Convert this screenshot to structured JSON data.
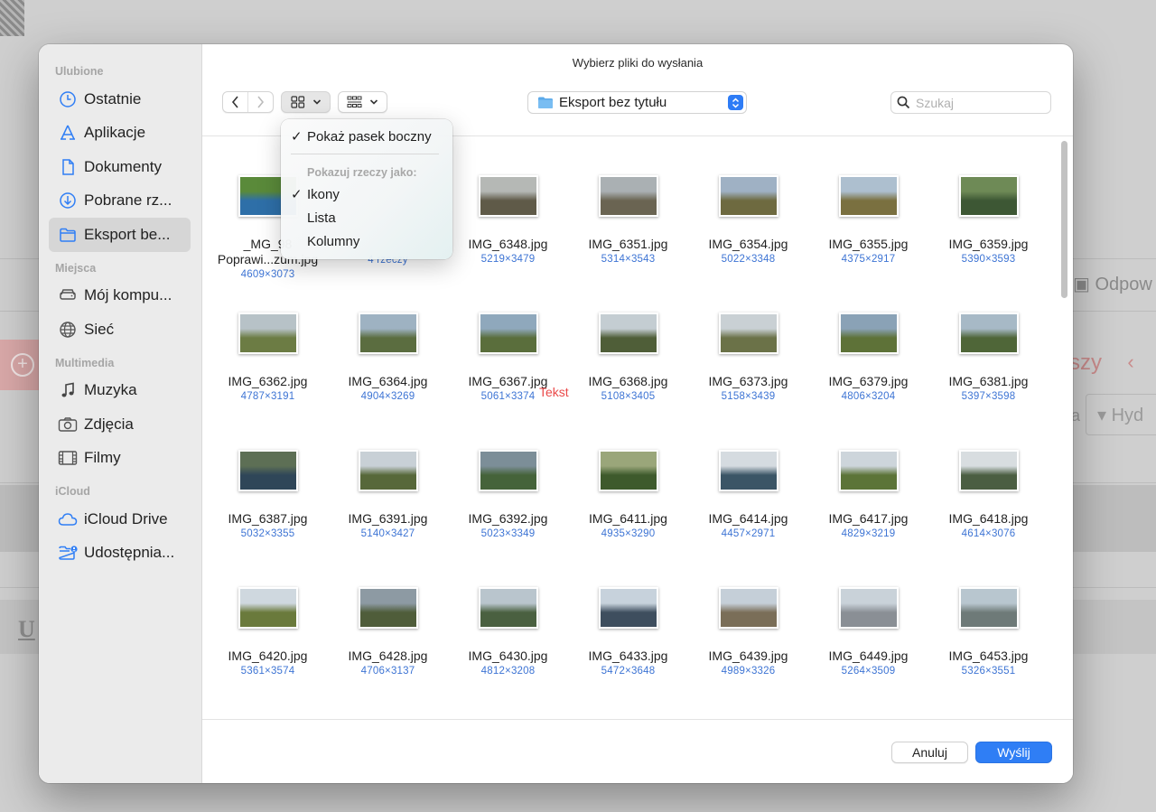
{
  "dialog_title": "Wybierz pliki do wysłania",
  "sidebar": {
    "sections": [
      {
        "title": "Ulubione",
        "items": [
          {
            "label": "Ostatnie",
            "icon": "clock-icon"
          },
          {
            "label": "Aplikacje",
            "icon": "apps-icon"
          },
          {
            "label": "Dokumenty",
            "icon": "document-icon"
          },
          {
            "label": "Pobrane rz...",
            "icon": "download-icon"
          },
          {
            "label": "Eksport be...",
            "icon": "folder-icon",
            "active": true
          }
        ]
      },
      {
        "title": "Miejsca",
        "items": [
          {
            "label": "Mój kompu...",
            "icon": "disk-icon"
          },
          {
            "label": "Sieć",
            "icon": "globe-icon"
          }
        ]
      },
      {
        "title": "Multimedia",
        "items": [
          {
            "label": "Muzyka",
            "icon": "music-icon"
          },
          {
            "label": "Zdjęcia",
            "icon": "camera-icon"
          },
          {
            "label": "Filmy",
            "icon": "film-icon"
          }
        ]
      },
      {
        "title": "iCloud",
        "items": [
          {
            "label": "iCloud Drive",
            "icon": "cloud-icon"
          },
          {
            "label": "Udostępnia...",
            "icon": "shared-folder-icon"
          }
        ]
      }
    ]
  },
  "path_popup": {
    "label": "Eksport bez tytułu"
  },
  "search": {
    "placeholder": "Szukaj"
  },
  "view_menu": {
    "show_sidebar": "Pokaż pasek boczny",
    "section_title": "Pokazuj rzeczy jako:",
    "options": [
      "Ikony",
      "Lista",
      "Kolumny"
    ],
    "selected": "Ikony"
  },
  "files": [
    {
      "name": "_MG_98",
      "name2": "Poprawi...zum.jpg",
      "dims": "4609×3073",
      "colors": [
        "#5a8a3a",
        "#2e6fa8"
      ]
    },
    {
      "name": "",
      "name2": "",
      "dims": "4 rzeczy",
      "colors": [
        "#e8e8e8",
        "#e8e8e8"
      ]
    },
    {
      "name": "IMG_6348.jpg",
      "dims": "5219×3479",
      "colors": [
        "#b5b8b5",
        "#5f5a48"
      ]
    },
    {
      "name": "IMG_6351.jpg",
      "dims": "5314×3543",
      "colors": [
        "#aab0b3",
        "#6a6452"
      ]
    },
    {
      "name": "IMG_6354.jpg",
      "dims": "5022×3348",
      "colors": [
        "#9fb1c4",
        "#6e6a40"
      ]
    },
    {
      "name": "IMG_6355.jpg",
      "dims": "4375×2917",
      "colors": [
        "#adbfcf",
        "#7a7040"
      ]
    },
    {
      "name": "IMG_6359.jpg",
      "dims": "5390×3593",
      "colors": [
        "#6e8a56",
        "#3d5734"
      ]
    },
    {
      "name": "IMG_6362.jpg",
      "dims": "4787×3191",
      "colors": [
        "#b7c2c7",
        "#6c7c44"
      ]
    },
    {
      "name": "IMG_6364.jpg",
      "dims": "4904×3269",
      "colors": [
        "#9eb2c2",
        "#5b6d40"
      ]
    },
    {
      "name": "IMG_6367.jpg",
      "dims": "5061×3374",
      "colors": [
        "#8fa8bc",
        "#5a6e3c"
      ]
    },
    {
      "name": "IMG_6368.jpg",
      "dims": "5108×3405",
      "colors": [
        "#c4cdd2",
        "#4f5e38"
      ]
    },
    {
      "name": "IMG_6373.jpg",
      "dims": "5158×3439",
      "colors": [
        "#c9d0d4",
        "#6b7248"
      ]
    },
    {
      "name": "IMG_6379.jpg",
      "dims": "4806×3204",
      "colors": [
        "#8aa2b6",
        "#5e7238"
      ]
    },
    {
      "name": "IMG_6381.jpg",
      "dims": "5397×3598",
      "colors": [
        "#a7b9c6",
        "#4f6638"
      ]
    },
    {
      "name": "IMG_6387.jpg",
      "dims": "5032×3355",
      "colors": [
        "#5d6f55",
        "#2f4658"
      ]
    },
    {
      "name": "IMG_6391.jpg",
      "dims": "5140×3427",
      "colors": [
        "#c8d0d6",
        "#57683a"
      ]
    },
    {
      "name": "IMG_6392.jpg",
      "dims": "5023×3349",
      "colors": [
        "#7c8e98",
        "#45633a"
      ]
    },
    {
      "name": "IMG_6411.jpg",
      "dims": "4935×3290",
      "colors": [
        "#9aa67a",
        "#3e5a2c"
      ]
    },
    {
      "name": "IMG_6414.jpg",
      "dims": "4457×2971",
      "colors": [
        "#d5dbe0",
        "#3b5566"
      ]
    },
    {
      "name": "IMG_6417.jpg",
      "dims": "4829×3219",
      "colors": [
        "#cdd5db",
        "#5c7438"
      ]
    },
    {
      "name": "IMG_6418.jpg",
      "dims": "4614×3076",
      "colors": [
        "#d8dde0",
        "#4b5e42"
      ]
    },
    {
      "name": "IMG_6420.jpg",
      "dims": "5361×3574",
      "colors": [
        "#cfd8df",
        "#6a7a3c"
      ]
    },
    {
      "name": "IMG_6428.jpg",
      "dims": "4706×3137",
      "colors": [
        "#8d9aa3",
        "#4f5d3a"
      ]
    },
    {
      "name": "IMG_6430.jpg",
      "dims": "4812×3208",
      "colors": [
        "#b9c5cd",
        "#4a6040"
      ]
    },
    {
      "name": "IMG_6433.jpg",
      "dims": "5472×3648",
      "colors": [
        "#c7d2dc",
        "#3e4e5e"
      ]
    },
    {
      "name": "IMG_6439.jpg",
      "dims": "4989×3326",
      "colors": [
        "#c5cfd8",
        "#7a6e58"
      ]
    },
    {
      "name": "IMG_6449.jpg",
      "dims": "5264×3509",
      "colors": [
        "#c9d2d9",
        "#8a8f95"
      ]
    },
    {
      "name": "IMG_6453.jpg",
      "dims": "5326×3551",
      "colors": [
        "#b8c6cf",
        "#6e7a78"
      ]
    }
  ],
  "annotation": "Tekst",
  "buttons": {
    "cancel": "Anuluj",
    "send": "Wyślij"
  },
  "background": {
    "fragment_right_top": "Odpow",
    "fragment_right_mid": "szy",
    "fragment_chevron": "‹",
    "fragment_a": "a",
    "fragment_hyd": "▾ Hyd",
    "fragment_u": "U"
  },
  "colors": {
    "accent": "#2f7ef5",
    "dims_text": "#3d74d4",
    "annotation": "#ea4a4a"
  }
}
